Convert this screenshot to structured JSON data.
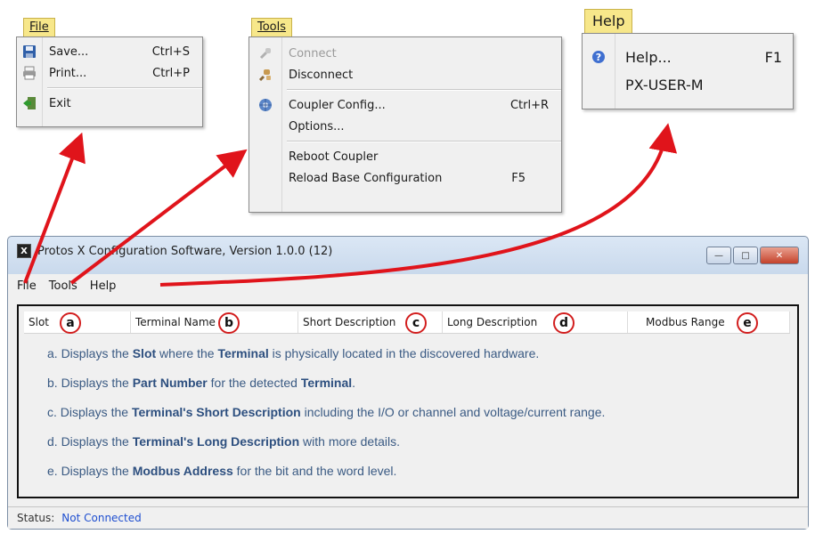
{
  "file_menu": {
    "tag": "File",
    "items": [
      {
        "label": "Save...",
        "shortcut": "Ctrl+S",
        "icon": "floppy-disk-icon"
      },
      {
        "label": "Print...",
        "shortcut": "Ctrl+P",
        "icon": "printer-icon"
      },
      {
        "label": "Exit",
        "shortcut": "",
        "icon": "exit-door-icon"
      }
    ]
  },
  "tools_menu": {
    "tag": "Tools",
    "items": [
      {
        "label": "Connect",
        "shortcut": "",
        "disabled": true,
        "icon": "plug-icon"
      },
      {
        "label": "Disconnect",
        "shortcut": "",
        "icon": "unplug-icon"
      },
      {
        "label": "Coupler Config...",
        "shortcut": "Ctrl+R",
        "icon": "gear-globe-icon"
      },
      {
        "label": "Options...",
        "shortcut": ""
      },
      {
        "label": "Reboot Coupler",
        "shortcut": ""
      },
      {
        "label": "Reload Base Configuration",
        "shortcut": "F5"
      }
    ]
  },
  "help_menu": {
    "tag": "Help",
    "items": [
      {
        "label": "Help...",
        "shortcut": "F1",
        "icon": "help-question-icon"
      },
      {
        "label": "PX-USER-M",
        "shortcut": ""
      }
    ]
  },
  "window": {
    "title": "Protos X Configuration Software, Version 1.0.0 (12)",
    "menubar": [
      "File",
      "Tools",
      "Help"
    ],
    "columns": [
      {
        "label": "Slot",
        "badge": "a"
      },
      {
        "label": "Terminal Name",
        "badge": "b"
      },
      {
        "label": "Short Description",
        "badge": "c"
      },
      {
        "label": "Long Description",
        "badge": "d"
      },
      {
        "label": "Modbus Range",
        "badge": "e"
      }
    ],
    "status_label": "Status:",
    "status_value": "Not Connected"
  },
  "descriptions": [
    {
      "pre": "a. Displays the ",
      "b1": "Slot",
      "mid": " where the ",
      "b2": "Terminal",
      "post": " is physically located in the discovered hardware."
    },
    {
      "pre": "b. Displays the ",
      "b1": "Part Number",
      "mid": " for the detected ",
      "b2": "Terminal",
      "post": "."
    },
    {
      "pre": "c. Displays the ",
      "b1": "Terminal's Short Description",
      "mid": " including the I/O or channel and voltage/current range.",
      "b2": "",
      "post": ""
    },
    {
      "pre": "d. Displays the ",
      "b1": "Terminal's Long Description",
      "mid": " with more details.",
      "b2": "",
      "post": ""
    },
    {
      "pre": "e. Displays the ",
      "b1": "Modbus Address",
      "mid": " for the bit and the word level.",
      "b2": "",
      "post": ""
    }
  ],
  "colors": {
    "arrow": "#e0141b",
    "menu_tag": "#f7e78a",
    "status_value": "#1f4fd0",
    "description_text": "#3a5a83"
  }
}
